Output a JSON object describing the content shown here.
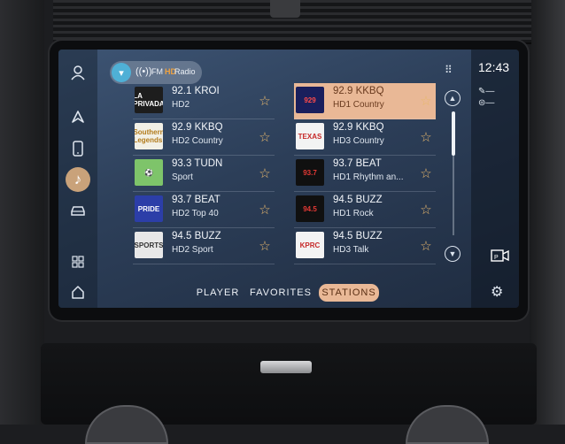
{
  "header": {
    "source": {
      "fm_label": "FM",
      "hd_label": "HD",
      "radio_label": "Radio",
      "icons": [
        "chevron-down-icon",
        "broadcast-icon"
      ]
    },
    "clock": "12:43"
  },
  "stations_left": [
    {
      "freq": "92.1 KROI",
      "sub": "HD2",
      "logo_text": "LA PRIVADA",
      "logo_bg": "#1d1d1d",
      "logo_fg": "#ffffff"
    },
    {
      "freq": "92.9 KKBQ",
      "sub": "HD2 Country",
      "logo_text": "Southern Legends",
      "logo_bg": "#f2f0e6",
      "logo_fg": "#b27b1c"
    },
    {
      "freq": "93.3 TUDN",
      "sub": "Sport",
      "logo_text": "⚽",
      "logo_bg": "#7ec46a",
      "logo_fg": "#ffffff"
    },
    {
      "freq": "93.7 BEAT",
      "sub": "HD2 Top 40",
      "logo_text": "PRIDE",
      "logo_bg": "#2c3ea8",
      "logo_fg": "#ffffff"
    },
    {
      "freq": "94.5 BUZZ",
      "sub": "HD2 Sport",
      "logo_text": "SPORTS",
      "logo_bg": "#e8e8e8",
      "logo_fg": "#333333"
    }
  ],
  "stations_right": [
    {
      "freq": "92.9 KKBQ",
      "sub": "HD1 Country",
      "logo_text": "929",
      "logo_bg": "#1a1f5c",
      "logo_fg": "#ff4a4a",
      "selected": true
    },
    {
      "freq": "92.9 KKBQ",
      "sub": "HD3 Country",
      "logo_text": "TEXAS",
      "logo_bg": "#f3f3f3",
      "logo_fg": "#c62828"
    },
    {
      "freq": "93.7 BEAT",
      "sub": "HD1 Rhythm an...",
      "logo_text": "93.7",
      "logo_bg": "#101010",
      "logo_fg": "#e53935"
    },
    {
      "freq": "94.5 BUZZ",
      "sub": "HD1 Rock",
      "logo_text": "94.5",
      "logo_bg": "#101010",
      "logo_fg": "#e53935"
    },
    {
      "freq": "94.5 BUZZ",
      "sub": "HD3 Talk",
      "logo_text": "KPRC",
      "logo_bg": "#f3f3f3",
      "logo_fg": "#c62828"
    }
  ],
  "tabs": [
    {
      "label": "PLAYER"
    },
    {
      "label": "FAVORITES"
    },
    {
      "label": "STATIONS",
      "active": true
    }
  ],
  "colors": {
    "accent": "#e9b896",
    "star": "#e8b86e",
    "screen_bg": "#2c3e58"
  },
  "icons": {
    "rail": [
      "user-icon",
      "navigation-icon",
      "phone-icon",
      "music-icon",
      "car-icon",
      "apps-grid-icon",
      "home-icon"
    ],
    "right": [
      "numpad-icon",
      "edit-icon",
      "presets-icon",
      "pager-icon",
      "settings-icon"
    ]
  }
}
